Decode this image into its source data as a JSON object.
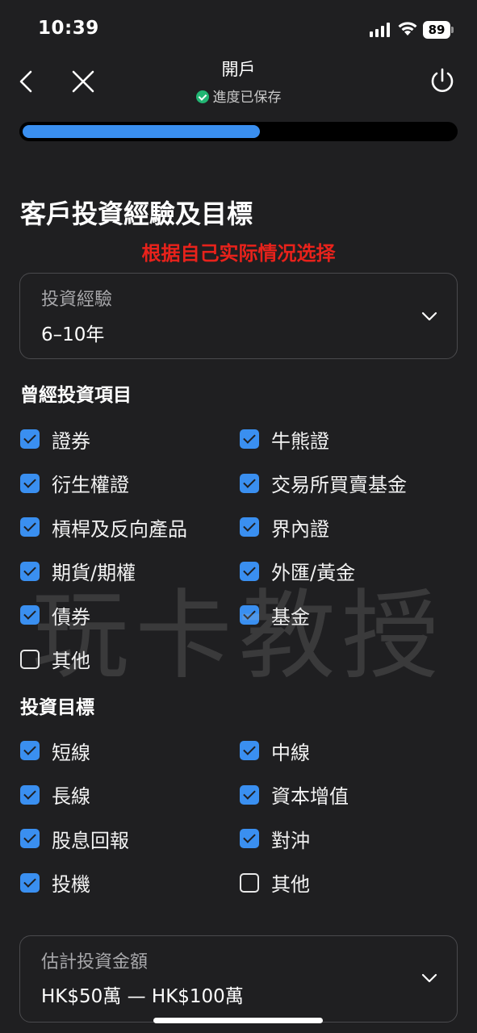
{
  "status_bar": {
    "time": "10:39",
    "battery": "89"
  },
  "nav": {
    "title": "開戶",
    "saved_text": "進度已保存"
  },
  "progress": {
    "fraction": 0.55
  },
  "page_title": "客戶投資經驗及目標",
  "overlay_note": "根据自己实际情况选择",
  "experience_select": {
    "label": "投資經驗",
    "value": "6–10年"
  },
  "products": {
    "title": "曾經投資項目",
    "options": [
      {
        "label": "證券",
        "checked": true
      },
      {
        "label": "牛熊證",
        "checked": true
      },
      {
        "label": "衍生權證",
        "checked": true
      },
      {
        "label": "交易所買賣基金",
        "checked": true
      },
      {
        "label": "槓桿及反向產品",
        "checked": true
      },
      {
        "label": "界內證",
        "checked": true
      },
      {
        "label": "期貨/期權",
        "checked": true
      },
      {
        "label": "外匯/黃金",
        "checked": true
      },
      {
        "label": "債券",
        "checked": true
      },
      {
        "label": "基金",
        "checked": true
      },
      {
        "label": "其他",
        "checked": false
      }
    ]
  },
  "objectives": {
    "title": "投資目標",
    "options": [
      {
        "label": "短線",
        "checked": true
      },
      {
        "label": "中線",
        "checked": true
      },
      {
        "label": "長線",
        "checked": true
      },
      {
        "label": "資本增值",
        "checked": true
      },
      {
        "label": "股息回報",
        "checked": true
      },
      {
        "label": "對沖",
        "checked": true
      },
      {
        "label": "投機",
        "checked": true
      },
      {
        "label": "其他",
        "checked": false
      }
    ]
  },
  "amount_select": {
    "label": "估計投資金額",
    "value": "HK$50萬 — HK$100萬"
  },
  "watermark": "玩卡教授",
  "colors": {
    "accent": "#3a8ff0",
    "background": "#1f1f21",
    "saved": "#22b573",
    "note": "#e8221b"
  },
  "icons": [
    "back-chevron-icon",
    "close-icon",
    "power-icon",
    "check-circle-icon",
    "chevron-down-icon",
    "checkbox-checked-icon",
    "checkbox-empty-icon"
  ]
}
